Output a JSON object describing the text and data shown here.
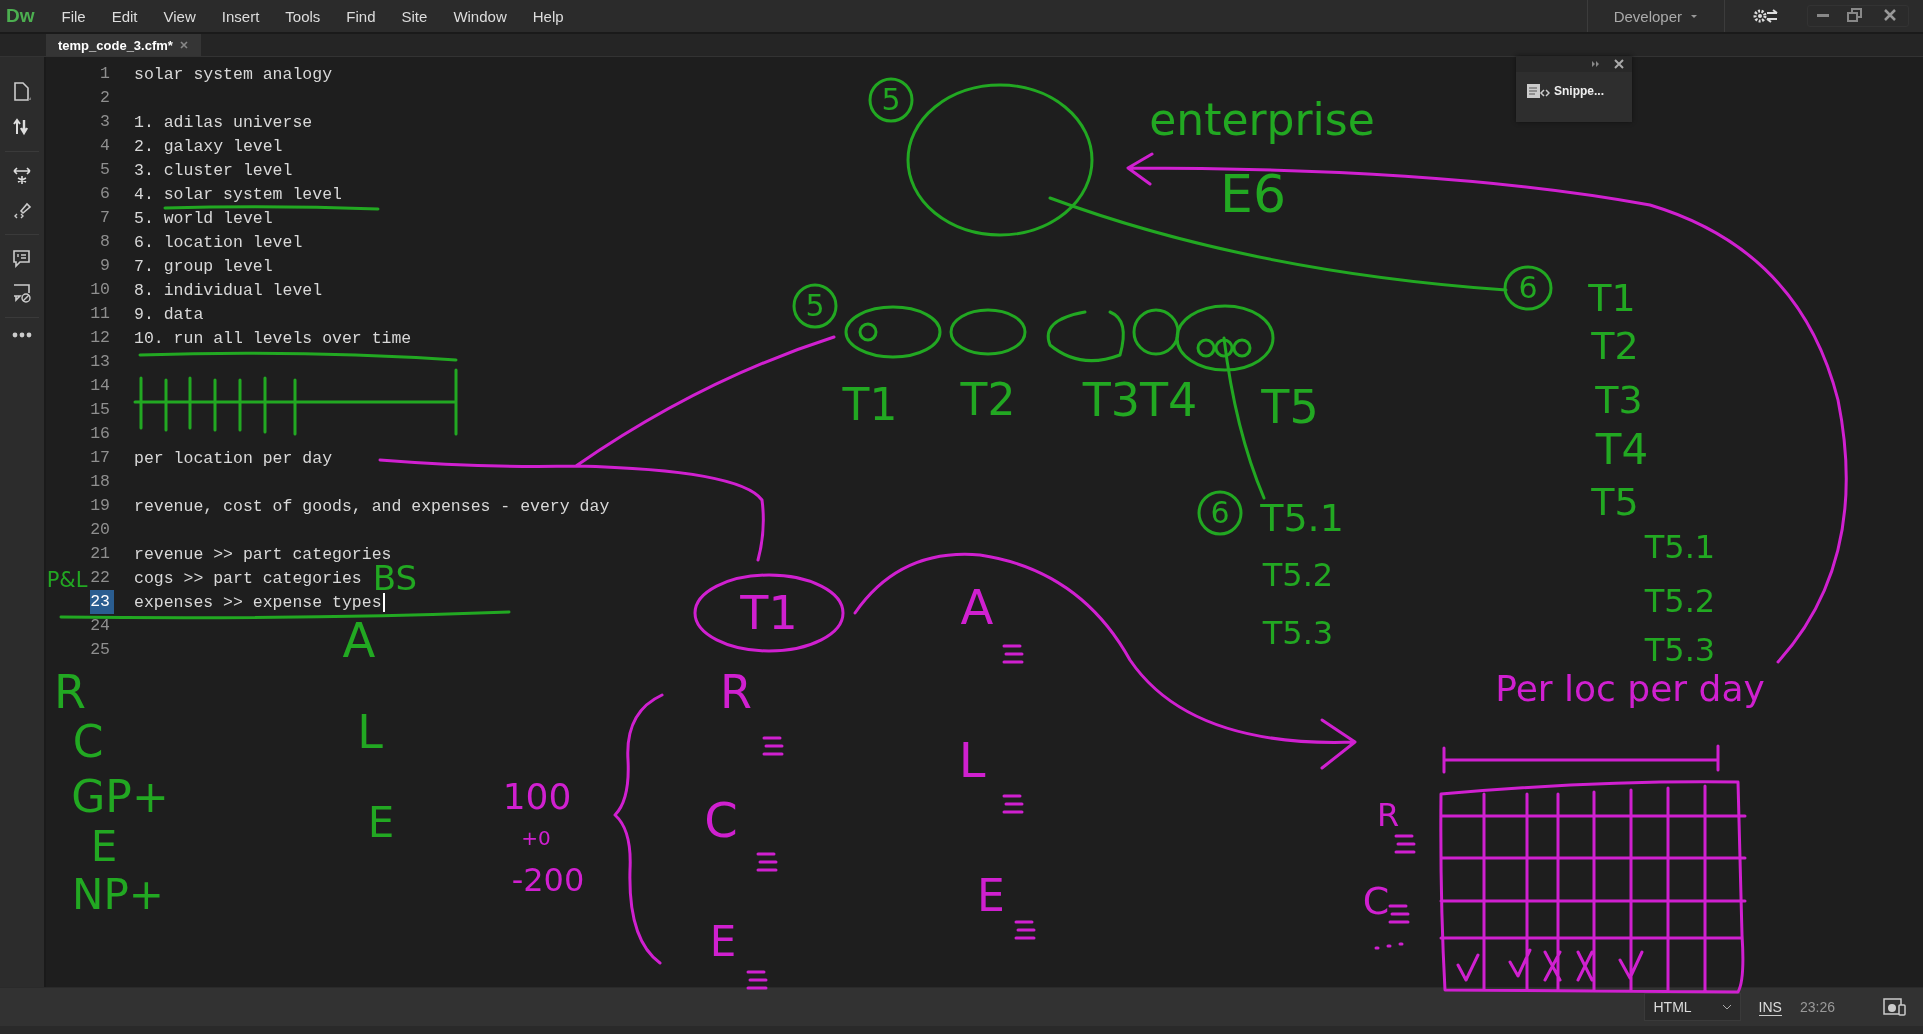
{
  "app": {
    "logo": "Dw",
    "menu": [
      "File",
      "Edit",
      "View",
      "Insert",
      "Tools",
      "Find",
      "Site",
      "Window",
      "Help"
    ],
    "workspace": "Developer"
  },
  "tabs": [
    {
      "label": "temp_code_3.cfm*",
      "selected": true
    }
  ],
  "editor": {
    "lines": [
      {
        "number": "1",
        "text": "solar system analogy",
        "selected": false
      },
      {
        "number": "2",
        "selected": false
      },
      {
        "number": "3",
        "text": "1. adilas universe",
        "selected": false
      },
      {
        "number": "4",
        "text": "2. galaxy level",
        "selected": false
      },
      {
        "number": "5",
        "text": "3. cluster level",
        "selected": false
      },
      {
        "number": "6",
        "text": "4. solar system level",
        "selected": false
      },
      {
        "number": "7",
        "text": "5. world level",
        "selected": false
      },
      {
        "number": "8",
        "text": "6. location level",
        "selected": false
      },
      {
        "number": "9",
        "text": "7. group level",
        "selected": false
      },
      {
        "number": "10",
        "text": "8. individual level",
        "selected": false
      },
      {
        "number": "11",
        "text": "9. data",
        "selected": false
      },
      {
        "number": "12",
        "text": "10. run all levels over time",
        "selected": false
      },
      {
        "number": "13",
        "selected": false
      },
      {
        "number": "14",
        "selected": false
      },
      {
        "number": "15",
        "selected": false
      },
      {
        "number": "16",
        "selected": false
      },
      {
        "number": "17",
        "text": "per location per day",
        "selected": false
      },
      {
        "number": "18",
        "selected": false
      },
      {
        "number": "19",
        "text": "revenue, cost of goods, and expenses - every day",
        "selected": false
      },
      {
        "number": "20",
        "selected": false
      },
      {
        "number": "21",
        "text": "revenue >> part categories",
        "selected": false
      },
      {
        "number": "22",
        "text": "cogs >> part categories",
        "selected": false
      },
      {
        "number": "23",
        "text": "expenses >> expense types",
        "selected": true
      },
      {
        "number": "24",
        "selected": false
      },
      {
        "number": "25",
        "selected": false
      }
    ]
  },
  "snippets_panel": {
    "label": "Snippe..."
  },
  "ink_notes": [
    {
      "text": "5",
      "color": "#22a822"
    },
    {
      "text": "enterprise",
      "color": "#22a822"
    },
    {
      "text": "E6",
      "color": "#22a822"
    },
    {
      "text": "5",
      "color": "#22a822"
    },
    {
      "text": "6",
      "color": "#22a822"
    },
    {
      "text": "T1",
      "color": "#22a822"
    },
    {
      "text": "T2",
      "color": "#22a822"
    },
    {
      "text": "T1",
      "color": "#22a822"
    },
    {
      "text": "T2",
      "color": "#22a822"
    },
    {
      "text": "T3T4",
      "color": "#22a822"
    },
    {
      "text": "T5",
      "color": "#22a822"
    },
    {
      "text": "T3",
      "color": "#22a822"
    },
    {
      "text": "T4",
      "color": "#22a822"
    },
    {
      "text": "6",
      "color": "#22a822"
    },
    {
      "text": "T5.1",
      "color": "#22a822"
    },
    {
      "text": "T5",
      "color": "#22a822"
    },
    {
      "text": "T5.1",
      "color": "#22a822"
    },
    {
      "text": "P&L",
      "color": "#22a822"
    },
    {
      "text": "BS",
      "color": "#22a822"
    },
    {
      "text": "T1",
      "color": "#d020d0"
    },
    {
      "text": "A",
      "color": "#d020d0"
    },
    {
      "text": "T5.2",
      "color": "#22a822"
    },
    {
      "text": "T5.2",
      "color": "#22a822"
    },
    {
      "text": "A",
      "color": "#22a822"
    },
    {
      "text": "T5.3",
      "color": "#22a822"
    },
    {
      "text": "T5.3",
      "color": "#22a822"
    },
    {
      "text": "R",
      "color": "#22a822"
    },
    {
      "text": "R",
      "color": "#d020d0"
    },
    {
      "text": "Per loc per day",
      "color": "#d020d0"
    },
    {
      "text": "C",
      "color": "#22a822"
    },
    {
      "text": "L",
      "color": "#22a822"
    },
    {
      "text": "L",
      "color": "#d020d0"
    },
    {
      "text": "GP+",
      "color": "#22a822"
    },
    {
      "text": "E",
      "color": "#22a822"
    },
    {
      "text": "100",
      "color": "#d020d0"
    },
    {
      "text": "C",
      "color": "#d020d0"
    },
    {
      "text": "R",
      "color": "#d020d0"
    },
    {
      "text": "E",
      "color": "#22a822"
    },
    {
      "text": "+0",
      "color": "#d020d0"
    },
    {
      "text": "NP+",
      "color": "#22a822"
    },
    {
      "text": "-200",
      "color": "#d020d0"
    },
    {
      "text": "E",
      "color": "#d020d0"
    },
    {
      "text": "C",
      "color": "#d020d0"
    },
    {
      "text": "E",
      "color": "#d020d0"
    }
  ],
  "status_bar": {
    "language": "HTML",
    "mode": "INS",
    "position": "23:26"
  }
}
